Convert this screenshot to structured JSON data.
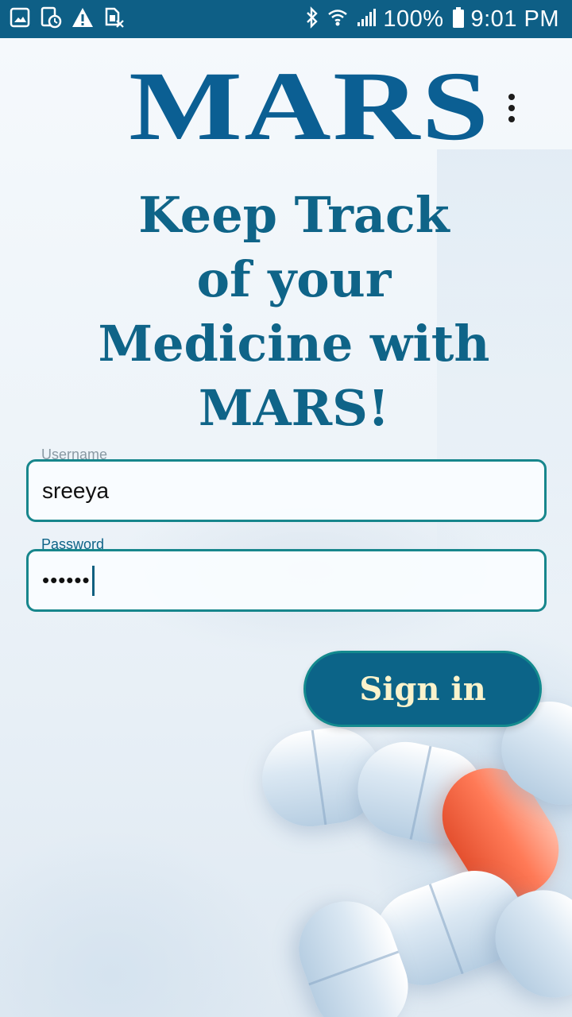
{
  "status_bar": {
    "battery": "100%",
    "time": "9:01 PM",
    "icons_left": [
      "image-icon",
      "calendar-clock-icon",
      "warning-icon",
      "no-sim-icon"
    ],
    "icons_right": [
      "bluetooth-icon",
      "wifi-icon",
      "signal-icon",
      "battery-icon"
    ]
  },
  "app": {
    "logo": "MARS",
    "menu_icon": "more-vert-icon"
  },
  "headline": {
    "line1": "Keep Track",
    "line2": "of your",
    "line3": "Medicine with",
    "line4": "MARS!"
  },
  "form": {
    "username_label": "Username",
    "username_value": "sreeya",
    "password_label": "Password",
    "password_value": "••••••",
    "signin_label": "Sign in"
  },
  "colors": {
    "status_bar": "#0e5f86",
    "brand": "#0b5f93",
    "headline": "#0f6488",
    "field_border": "#17868c",
    "button": "#0c6488",
    "button_text": "#fbf3cc"
  }
}
